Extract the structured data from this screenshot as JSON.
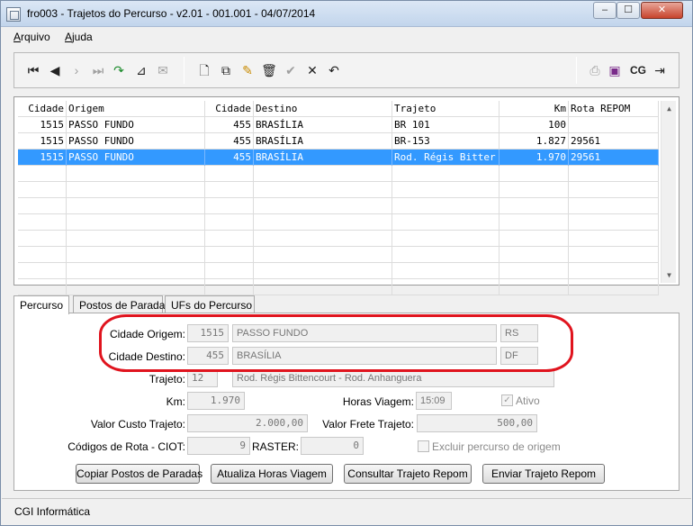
{
  "window": {
    "title": "fro003 - Trajetos do Percurso - v2.01 - 001.001 - 04/07/2014",
    "min": "‒",
    "max": "☐",
    "close": "✕"
  },
  "menu": {
    "arquivo_first": "A",
    "arquivo_rest": "rquivo",
    "ajuda_first": "A",
    "ajuda_rest": "juda"
  },
  "toolbar_icons": [
    "first-icon",
    "prev-icon",
    "next-icon",
    "last-icon",
    "refresh-icon",
    "filter-icon",
    "clear-filter-icon",
    "new-icon",
    "copy-icon",
    "edit-icon",
    "delete-icon",
    "confirm-icon",
    "cancel-icon",
    "undo-icon",
    "print-icon",
    "book-icon",
    "cg-icon",
    "exit-icon"
  ],
  "toolbar_text": {
    "cg": "CG"
  },
  "grid": {
    "headers": {
      "cod_origem": "Cidade",
      "origem": "Origem",
      "cod_destino": "Cidade",
      "destino": "Destino",
      "trajeto": "Trajeto",
      "km": "Km",
      "rota": "Rota REPOM"
    },
    "rows": [
      {
        "cod_origem": "1515",
        "origem": "PASSO FUNDO",
        "cod_destino": "455",
        "destino": "BRASÍLIA",
        "trajeto": "BR 101",
        "km": "100",
        "rota": ""
      },
      {
        "cod_origem": "1515",
        "origem": "PASSO FUNDO",
        "cod_destino": "455",
        "destino": "BRASÍLIA",
        "trajeto": "BR-153",
        "km": "1.827",
        "rota": "29561"
      },
      {
        "cod_origem": "1515",
        "origem": "PASSO FUNDO",
        "cod_destino": "455",
        "destino": "BRASÍLIA",
        "trajeto": "Rod. Régis Bitter",
        "km": "1.970",
        "rota": "29561"
      }
    ],
    "selected_row": 2
  },
  "tabs": [
    "Percurso",
    "Postos de Parada",
    "UFs do Percurso"
  ],
  "form": {
    "cidade_origem": {
      "label": "Cidade Origem:",
      "code": "1515",
      "name": "PASSO FUNDO",
      "uf": "RS"
    },
    "cidade_destino": {
      "label": "Cidade Destino:",
      "code": "455",
      "name": "BRASÍLIA",
      "uf": "DF"
    },
    "trajeto": {
      "label": "Trajeto:",
      "code": "12",
      "name": "Rod. Régis Bittencourt - Rod. Anhanguera"
    },
    "km": {
      "label": "Km:",
      "value": "1.970"
    },
    "horas_viagem": {
      "label": "Horas Viagem:",
      "value": "15:09"
    },
    "ativo": {
      "label": "Ativo",
      "checked": true
    },
    "valor_custo": {
      "label": "Valor Custo Trajeto:",
      "value": "2.000,00"
    },
    "valor_frete": {
      "label": "Valor Frete Trajeto:",
      "value": "500,00"
    },
    "codigos_rota": {
      "label": "Códigos de Rota - CIOT:",
      "value": "9"
    },
    "raster": {
      "label": "RASTER:",
      "value": "0"
    },
    "excluir": {
      "label": "Excluir percurso de origem",
      "checked": false
    }
  },
  "buttons": {
    "copiar": "Copiar Postos de Paradas",
    "atualiza": "Atualiza Horas Viagem",
    "consultar": "Consultar Trajeto Repom",
    "enviar": "Enviar Trajeto Repom"
  },
  "status": {
    "text": "CGI Informática"
  },
  "colors": {
    "selection": "#3399ff",
    "highlight": "#e0141e"
  }
}
